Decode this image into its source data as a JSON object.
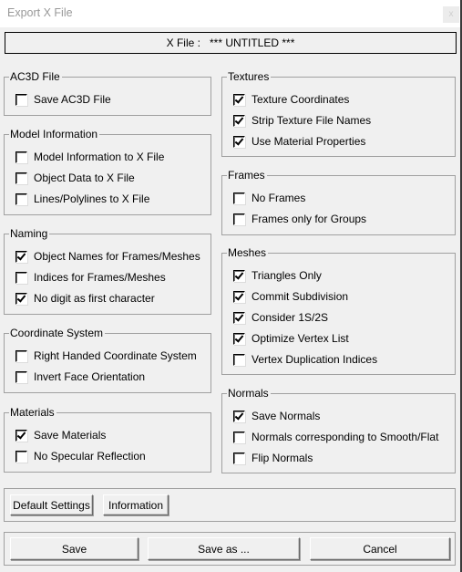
{
  "window": {
    "title": "Export X File",
    "close_glyph": "x"
  },
  "file_bar": {
    "label": "X File :",
    "value": "*** UNTITLED ***"
  },
  "groups": {
    "ac3d": {
      "title": "AC3D File",
      "items": [
        {
          "label": "Save AC3D File",
          "checked": false
        }
      ]
    },
    "model_info": {
      "title": "Model Information",
      "items": [
        {
          "label": "Model Information to X File",
          "checked": false
        },
        {
          "label": "Object Data to X File",
          "checked": false
        },
        {
          "label": "Lines/Polylines to X File",
          "checked": false
        }
      ]
    },
    "naming": {
      "title": "Naming",
      "items": [
        {
          "label": "Object Names for Frames/Meshes",
          "checked": true
        },
        {
          "label": "Indices for Frames/Meshes",
          "checked": false
        },
        {
          "label": "No digit as first character",
          "checked": true
        }
      ]
    },
    "coord": {
      "title": "Coordinate System",
      "items": [
        {
          "label": "Right Handed Coordinate System",
          "checked": false
        },
        {
          "label": "Invert Face Orientation",
          "checked": false
        }
      ]
    },
    "materials": {
      "title": "Materials",
      "items": [
        {
          "label": "Save Materials",
          "checked": true
        },
        {
          "label": "No Specular Reflection",
          "checked": false
        }
      ]
    },
    "textures": {
      "title": "Textures",
      "items": [
        {
          "label": "Texture Coordinates",
          "checked": true
        },
        {
          "label": "Strip Texture File Names",
          "checked": true
        },
        {
          "label": "Use Material Properties",
          "checked": true
        }
      ]
    },
    "frames": {
      "title": "Frames",
      "items": [
        {
          "label": "No Frames",
          "checked": false
        },
        {
          "label": "Frames only for Groups",
          "checked": false
        }
      ]
    },
    "meshes": {
      "title": "Meshes",
      "items": [
        {
          "label": "Triangles Only",
          "checked": true
        },
        {
          "label": "Commit Subdivision",
          "checked": true
        },
        {
          "label": "Consider 1S/2S",
          "checked": true
        },
        {
          "label": "Optimize Vertex List",
          "checked": true
        },
        {
          "label": "Vertex Duplication Indices",
          "checked": false
        }
      ]
    },
    "normals": {
      "title": "Normals",
      "items": [
        {
          "label": "Save Normals",
          "checked": true
        },
        {
          "label": "Normals corresponding to Smooth/Flat",
          "checked": false
        },
        {
          "label": "Flip Normals",
          "checked": false
        }
      ]
    }
  },
  "buttons": {
    "default_settings": "Default Settings",
    "information": "Information",
    "save": "Save",
    "save_as": "Save as ...",
    "cancel": "Cancel"
  }
}
